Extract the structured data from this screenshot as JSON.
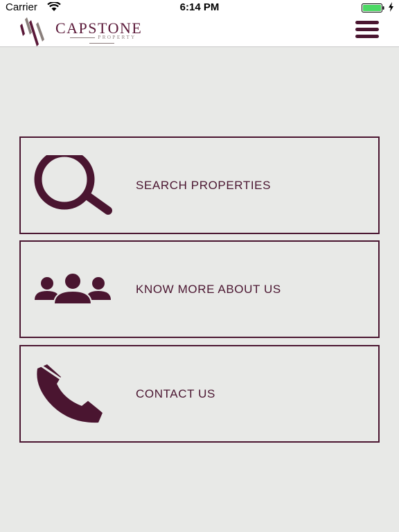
{
  "status_bar": {
    "carrier": "Carrier",
    "time": "6:14 PM",
    "battery_color": "#4cd964"
  },
  "header": {
    "logo_name": "CAPSTONE",
    "logo_subtitle": "PROPERTY",
    "menu_icon": "hamburger-icon"
  },
  "menu_cards": [
    {
      "label": "SEARCH PROPERTIES",
      "icon": "search-icon"
    },
    {
      "label": "KNOW MORE ABOUT US",
      "icon": "people-icon"
    },
    {
      "label": "CONTACT US",
      "icon": "phone-icon"
    }
  ],
  "colors": {
    "brand": "#4a1530",
    "background": "#e8e9e7"
  }
}
